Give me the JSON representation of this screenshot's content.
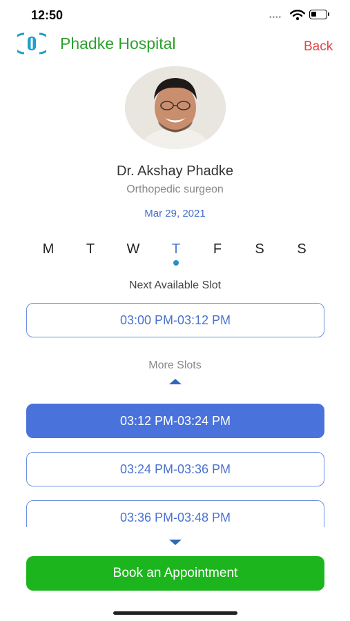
{
  "status_bar": {
    "time": "12:50",
    "signal": "••••"
  },
  "header": {
    "title": "Phadke Hospital",
    "back_label": "Back"
  },
  "doctor": {
    "name": "Dr. Akshay Phadke",
    "specialty": "Orthopedic surgeon",
    "date": "Mar 29, 2021"
  },
  "week": {
    "days": [
      "M",
      "T",
      "W",
      "T",
      "F",
      "S",
      "S"
    ],
    "selected_index": 3
  },
  "next_slot": {
    "label": "Next Available Slot",
    "time": "03:00 PM-03:12 PM"
  },
  "more_slots": {
    "label": "More Slots",
    "slots": [
      "03:12 PM-03:24 PM",
      "03:24 PM-03:36 PM",
      "03:36 PM-03:48 PM"
    ],
    "selected_index": 0
  },
  "book_button_label": "Book an Appointment",
  "colors": {
    "brand_green": "#2ca02c",
    "accent_blue": "#4a72db",
    "back_red": "#e64545",
    "book_green": "#1db51d"
  }
}
